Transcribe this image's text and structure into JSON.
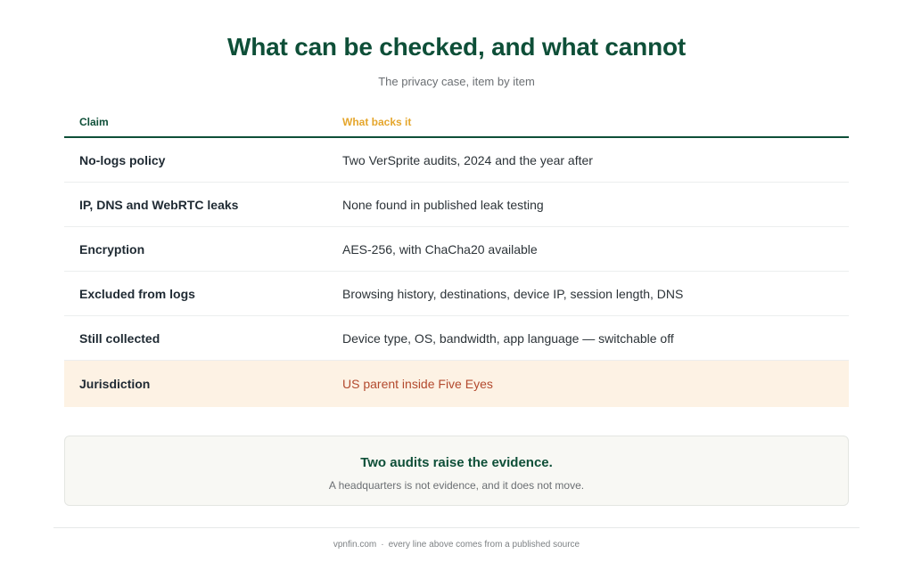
{
  "title": "What can be checked, and what cannot",
  "subtitle": "The privacy case, item by item",
  "table": {
    "headers": {
      "claim": "Claim",
      "backing": "What backs it"
    },
    "rows": [
      {
        "claim": "No-logs policy",
        "backing": "Two VerSprite audits, 2024 and the year after"
      },
      {
        "claim": "IP, DNS and WebRTC leaks",
        "backing": "None found in published leak testing"
      },
      {
        "claim": "Encryption",
        "backing": "AES-256, with ChaCha20 available"
      },
      {
        "claim": "Excluded from logs",
        "backing": "Browsing history, destinations, device IP, session length, DNS"
      },
      {
        "claim": "Still collected",
        "backing": "Device type, OS, bandwidth, app language — switchable off"
      },
      {
        "claim": "Jurisdiction",
        "backing": "US parent inside Five Eyes"
      }
    ]
  },
  "callout": {
    "heading": "Two audits raise the evidence.",
    "body": "A headquarters is not evidence, and it does not move."
  },
  "footer": {
    "site": "vpnfin.com",
    "separator": "·",
    "note": "every line above comes from a published source"
  },
  "colors": {
    "primary": "#0e4f38",
    "accent": "#e5a62c",
    "highlight_bg": "#fdf2e4",
    "highlight_text": "#b34a2e"
  }
}
